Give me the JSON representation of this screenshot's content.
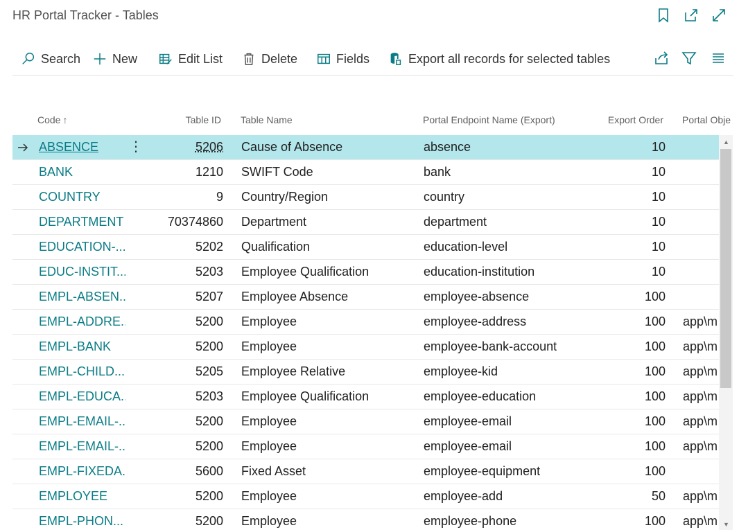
{
  "window": {
    "title": "HR Portal Tracker - Tables"
  },
  "toolbar": {
    "search": "Search",
    "new": "New",
    "edit_list": "Edit List",
    "delete": "Delete",
    "fields": "Fields",
    "export": "Export all records for selected tables"
  },
  "table": {
    "headers": {
      "code": "Code",
      "table_id": "Table ID",
      "table_name": "Table Name",
      "endpoint": "Portal Endpoint Name (Export)",
      "export_order": "Export Order",
      "portal_object": "Portal Obje"
    },
    "rows": [
      {
        "code": "ABSENCE",
        "table_id": "5206",
        "table_name": "Cause of Absence",
        "endpoint": "absence",
        "export_order": "10",
        "portal_object": ""
      },
      {
        "code": "BANK",
        "table_id": "1210",
        "table_name": "SWIFT Code",
        "endpoint": "bank",
        "export_order": "10",
        "portal_object": ""
      },
      {
        "code": "COUNTRY",
        "table_id": "9",
        "table_name": "Country/Region",
        "endpoint": "country",
        "export_order": "10",
        "portal_object": ""
      },
      {
        "code": "DEPARTMENT",
        "table_id": "70374860",
        "table_name": "Department",
        "endpoint": "department",
        "export_order": "10",
        "portal_object": ""
      },
      {
        "code": "EDUCATION-...",
        "table_id": "5202",
        "table_name": "Qualification",
        "endpoint": "education-level",
        "export_order": "10",
        "portal_object": ""
      },
      {
        "code": "EDUC-INSTIT...",
        "table_id": "5203",
        "table_name": "Employee Qualification",
        "endpoint": "education-institution",
        "export_order": "10",
        "portal_object": ""
      },
      {
        "code": "EMPL-ABSEN...",
        "table_id": "5207",
        "table_name": "Employee Absence",
        "endpoint": "employee-absence",
        "export_order": "100",
        "portal_object": ""
      },
      {
        "code": "EMPL-ADDRE...",
        "table_id": "5200",
        "table_name": "Employee",
        "endpoint": "employee-address",
        "export_order": "100",
        "portal_object": "app\\m"
      },
      {
        "code": "EMPL-BANK",
        "table_id": "5200",
        "table_name": "Employee",
        "endpoint": "employee-bank-account",
        "export_order": "100",
        "portal_object": "app\\m"
      },
      {
        "code": "EMPL-CHILD...",
        "table_id": "5205",
        "table_name": "Employee Relative",
        "endpoint": "employee-kid",
        "export_order": "100",
        "portal_object": "app\\m"
      },
      {
        "code": "EMPL-EDUCA...",
        "table_id": "5203",
        "table_name": "Employee Qualification",
        "endpoint": "employee-education",
        "export_order": "100",
        "portal_object": "app\\m"
      },
      {
        "code": "EMPL-EMAIL-...",
        "table_id": "5200",
        "table_name": "Employee",
        "endpoint": "employee-email",
        "export_order": "100",
        "portal_object": "app\\m"
      },
      {
        "code": "EMPL-EMAIL-...",
        "table_id": "5200",
        "table_name": "Employee",
        "endpoint": "employee-email",
        "export_order": "100",
        "portal_object": "app\\m"
      },
      {
        "code": "EMPL-FIXEDA...",
        "table_id": "5600",
        "table_name": "Fixed Asset",
        "endpoint": "employee-equipment",
        "export_order": "100",
        "portal_object": ""
      },
      {
        "code": "EMPLOYEE",
        "table_id": "5200",
        "table_name": "Employee",
        "endpoint": "employee-add",
        "export_order": "50",
        "portal_object": "app\\m"
      },
      {
        "code": "EMPL-PHON...",
        "table_id": "5200",
        "table_name": "Employee",
        "endpoint": "employee-phone",
        "export_order": "100",
        "portal_object": "app\\m"
      }
    ]
  },
  "icons": {
    "bookmark": "bookmark-icon",
    "open_new": "open-in-new-window-icon",
    "expand": "expand-icon",
    "share": "share-icon",
    "filter": "filter-icon",
    "list": "list-view-icon"
  },
  "colors": {
    "accent": "#0a7c86",
    "selected_row": "#b3e7ec"
  }
}
